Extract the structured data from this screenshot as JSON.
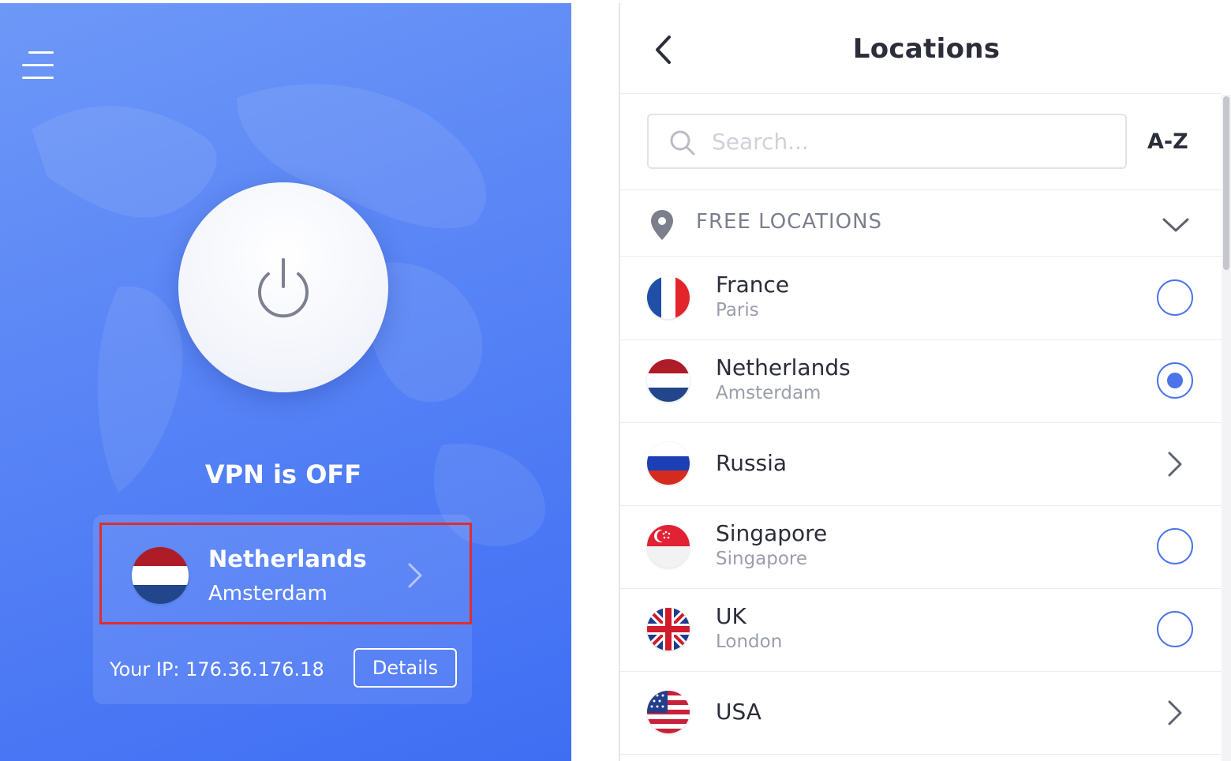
{
  "main": {
    "status": "VPN is OFF",
    "selected_location": {
      "country": "Netherlands",
      "city": "Amsterdam"
    },
    "ip_text": "Your IP: 176.36.176.18",
    "details_label": "Details"
  },
  "locations": {
    "title": "Locations",
    "search_placeholder": "Search...",
    "sort_label": "A-Z",
    "section_label": "FREE LOCATIONS",
    "items": [
      {
        "country": "France",
        "city": "Paris",
        "control": "radio",
        "selected": false
      },
      {
        "country": "Netherlands",
        "city": "Amsterdam",
        "control": "radio",
        "selected": true
      },
      {
        "country": "Russia",
        "city": "",
        "control": "chevron",
        "selected": false
      },
      {
        "country": "Singapore",
        "city": "Singapore",
        "control": "radio",
        "selected": false
      },
      {
        "country": "UK",
        "city": "London",
        "control": "radio",
        "selected": false
      },
      {
        "country": "USA",
        "city": "",
        "control": "chevron",
        "selected": false
      }
    ]
  },
  "colors": {
    "panel_blue": "#5a86f6",
    "accent": "#4a74e8",
    "highlight_border": "#e02d2d"
  }
}
